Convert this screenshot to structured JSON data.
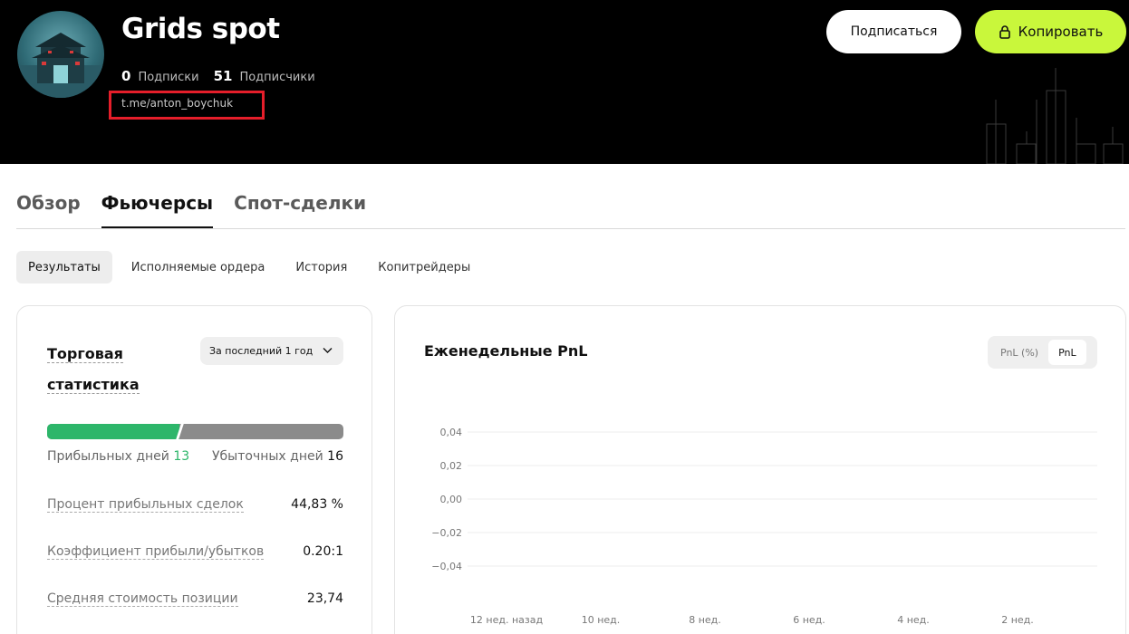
{
  "header": {
    "name": "Grids spot",
    "following_count": "0",
    "following_label": "Подписки",
    "followers_count": "51",
    "followers_label": "Подписчики",
    "link": "t.me/anton_boychuk",
    "subscribe_label": "Подписаться",
    "copy_label": "Копировать"
  },
  "tabs": [
    {
      "label": "Обзор",
      "active": false
    },
    {
      "label": "Фьючерсы",
      "active": true
    },
    {
      "label": "Спот-сделки",
      "active": false
    }
  ],
  "sub_tabs": [
    {
      "label": "Результаты",
      "active": true
    },
    {
      "label": "Исполняемые ордера",
      "active": false
    },
    {
      "label": "История",
      "active": false
    },
    {
      "label": "Копитрейдеры",
      "active": false
    }
  ],
  "stats": {
    "title_line1": "Торговая",
    "title_line2": "статистика",
    "period": "За последний 1 год",
    "profit_days_label": "Прибыльных дней",
    "profit_days": "13",
    "loss_days_label": "Убыточных дней",
    "loss_days": "16",
    "profit_ratio": 0.448,
    "metrics": [
      {
        "label": "Процент прибыльных сделок",
        "value": "44,83 %"
      },
      {
        "label": "Коэффициент прибыли/убытков",
        "value": "0.20:1"
      },
      {
        "label": "Средняя стоимость позиции",
        "value": "23,74"
      }
    ]
  },
  "pnl": {
    "title": "Еженедельные PnL",
    "toggle_percent": "PnL (%)",
    "toggle_abs": "PnL"
  },
  "chart_data": {
    "type": "bar",
    "title": "Еженедельные PnL",
    "y_ticks": [
      "0,04",
      "0,02",
      "0,00",
      "−0,02",
      "−0,04"
    ],
    "ylim": [
      -0.04,
      0.04
    ],
    "x_ticks": [
      "12 нед. назад",
      "10 нед.",
      "8 нед.",
      "6 нед.",
      "4 нед.",
      "2 нед."
    ],
    "values": [],
    "grid": true
  },
  "colors": {
    "accent": "#c9f73b",
    "profit": "#2db66a",
    "loss": "#8b8b8b",
    "highlight": "#e51e2a"
  }
}
